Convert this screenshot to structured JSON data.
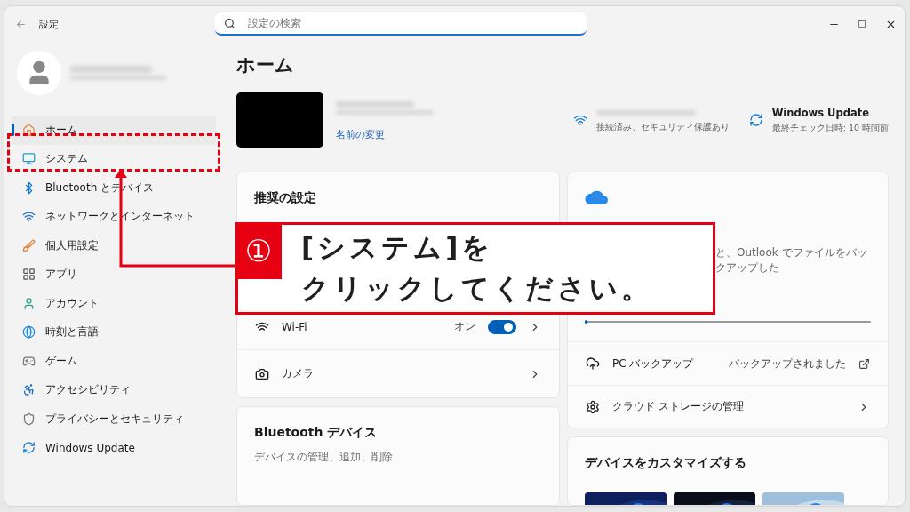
{
  "window": {
    "title": "設定",
    "search": {
      "placeholder": "設定の検索"
    }
  },
  "sidebar": {
    "items": [
      {
        "label": "ホーム",
        "kind": "home",
        "selected": true
      },
      {
        "label": "システム",
        "kind": "system",
        "selected": false
      },
      {
        "label": "Bluetooth とデバイス",
        "kind": "bluetooth",
        "selected": false
      },
      {
        "label": "ネットワークとインターネット",
        "kind": "network",
        "selected": false
      },
      {
        "label": "個人用設定",
        "kind": "personalization",
        "selected": false
      },
      {
        "label": "アプリ",
        "kind": "apps",
        "selected": false
      },
      {
        "label": "アカウント",
        "kind": "accounts",
        "selected": false
      },
      {
        "label": "時刻と言語",
        "kind": "time",
        "selected": false
      },
      {
        "label": "ゲーム",
        "kind": "gaming",
        "selected": false
      },
      {
        "label": "アクセシビリティ",
        "kind": "accessibility",
        "selected": false
      },
      {
        "label": "プライバシーとセキュリティ",
        "kind": "privacy",
        "selected": false
      },
      {
        "label": "Windows Update",
        "kind": "update",
        "selected": false
      }
    ]
  },
  "page": {
    "title": "ホーム",
    "rename_link": "名前の変更",
    "wifi_status": "接続済み、セキュリティ保護あり",
    "update_status": {
      "title": "Windows Update",
      "text": "最終チェック日時: 10 時間前"
    }
  },
  "recommended": {
    "title": "推奨の設定",
    "rows": [
      {
        "label": "Wi-Fi",
        "kind": "toggle",
        "value": "オン",
        "on": true
      },
      {
        "label": "カメラ",
        "kind": "camera"
      }
    ]
  },
  "bluetooth": {
    "title": "Bluetooth デバイス",
    "subtitle": "デバイスの管理、追加、削除"
  },
  "cloud": {
    "description_visible": "と、Outlook でファイルをバックアップした",
    "level": 0.005,
    "rows": [
      {
        "label": "PC バックアップ",
        "kind": "backup",
        "value": "バックアップされました"
      },
      {
        "label": "クラウド ストレージの管理",
        "kind": "manage"
      }
    ]
  },
  "customize": {
    "title": "デバイスをカスタマイズする"
  },
  "callout": {
    "number": "①",
    "lines": [
      "[システム]を",
      "クリックしてください。"
    ]
  }
}
